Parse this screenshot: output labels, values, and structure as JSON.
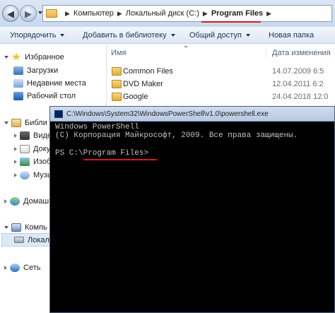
{
  "address_bar": {
    "crumbs": [
      "Компьютер",
      "Локальный диск (C:)",
      "Program Files"
    ]
  },
  "toolbar": {
    "organize": "Упорядочить",
    "add_to_library": "Добавить в библиотеку",
    "share": "Общий доступ",
    "new_folder": "Новая папка"
  },
  "sidebar": {
    "favorites": "Избранное",
    "favorites_items": [
      "Загрузки",
      "Недавние места",
      "Рабочий стол"
    ],
    "libraries": "Библи",
    "library_items": [
      "Видео",
      "Доку",
      "Изоб",
      "Музы"
    ],
    "homegroup": "Домаш",
    "computer": "Компь",
    "local_disk": "Локал",
    "network": "Сеть"
  },
  "file_list": {
    "columns": {
      "name": "Имя",
      "date": "Дата изменения"
    },
    "rows": [
      {
        "name": "Common Files",
        "date": "14.07.2009 6:5"
      },
      {
        "name": "DVD Maker",
        "date": "12.04.2011 6:2"
      },
      {
        "name": "Google",
        "date": "24.04.2018 12:0"
      }
    ]
  },
  "powershell": {
    "title": "C:\\Windows\\System32\\WindowsPowerShell\\v1.0\\powershell.exe",
    "lines": [
      "Windows PowerShell",
      "(C) Корпорация Майкрософт, 2009. Все права защищены.",
      "",
      "PS C:\\Program Files>"
    ]
  },
  "colors": {
    "highlight_underline": "#d21a1a",
    "console_bg": "#000000",
    "console_fg": "#c0c0c0"
  }
}
